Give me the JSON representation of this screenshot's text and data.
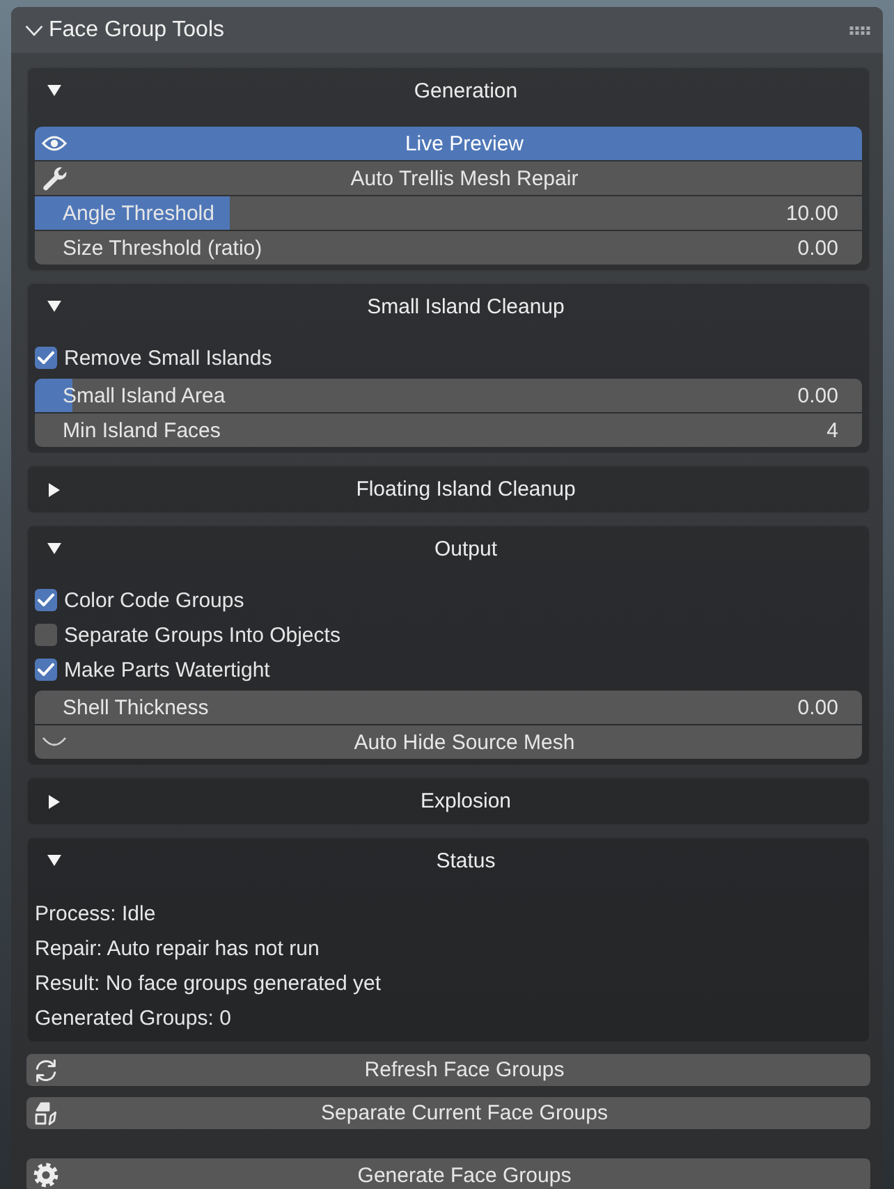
{
  "panel": {
    "title": "Face Group Tools",
    "expanded": true
  },
  "sections": [
    {
      "title": "Generation",
      "expanded": true,
      "items": [
        {
          "kind": "toggle",
          "label": "Live Preview",
          "on": true
        },
        {
          "kind": "toggle",
          "label": "Auto Trellis Mesh Repair",
          "on": false
        },
        {
          "kind": "slider",
          "label": "Angle Threshold",
          "value": "10.00",
          "level": 0.235
        },
        {
          "kind": "number",
          "label": "Size Threshold (ratio)",
          "value": "0.00"
        }
      ]
    },
    {
      "title": "Small Island Cleanup",
      "expanded": true,
      "items": [
        {
          "kind": "checkbox",
          "label": "Remove Small Islands",
          "checked": true
        },
        {
          "kind": "slider",
          "label": "Small Island Area",
          "value": "0.00",
          "level": 0.045
        },
        {
          "kind": "number",
          "label": "Min Island Faces",
          "value": "4"
        }
      ]
    },
    {
      "title": "Floating Island Cleanup",
      "expanded": false
    },
    {
      "title": "Output",
      "expanded": true,
      "items": [
        {
          "kind": "checkbox",
          "label": "Color Code Groups",
          "checked": true
        },
        {
          "kind": "checkbox",
          "label": "Separate Groups Into Objects",
          "checked": false
        },
        {
          "kind": "checkbox",
          "label": "Make Parts Watertight",
          "checked": true
        },
        {
          "kind": "number",
          "label": "Shell Thickness",
          "value": "0.00"
        },
        {
          "kind": "toggle",
          "label": "Auto Hide Source Mesh",
          "on": false
        }
      ]
    },
    {
      "title": "Explosion",
      "expanded": false
    },
    {
      "title": "Status",
      "expanded": true,
      "items": [
        {
          "kind": "text",
          "label": "Process: Idle"
        },
        {
          "kind": "text",
          "label": "Repair: Auto repair has not run"
        },
        {
          "kind": "text",
          "label": "Result: No face groups generated yet"
        },
        {
          "kind": "text",
          "label": "Generated Groups: 0"
        }
      ]
    }
  ],
  "buttons": [
    {
      "label": "Refresh Face Groups"
    },
    {
      "label": "Separate Current Face Groups"
    }
  ],
  "generate_button": {
    "label": "Generate Face Groups"
  }
}
